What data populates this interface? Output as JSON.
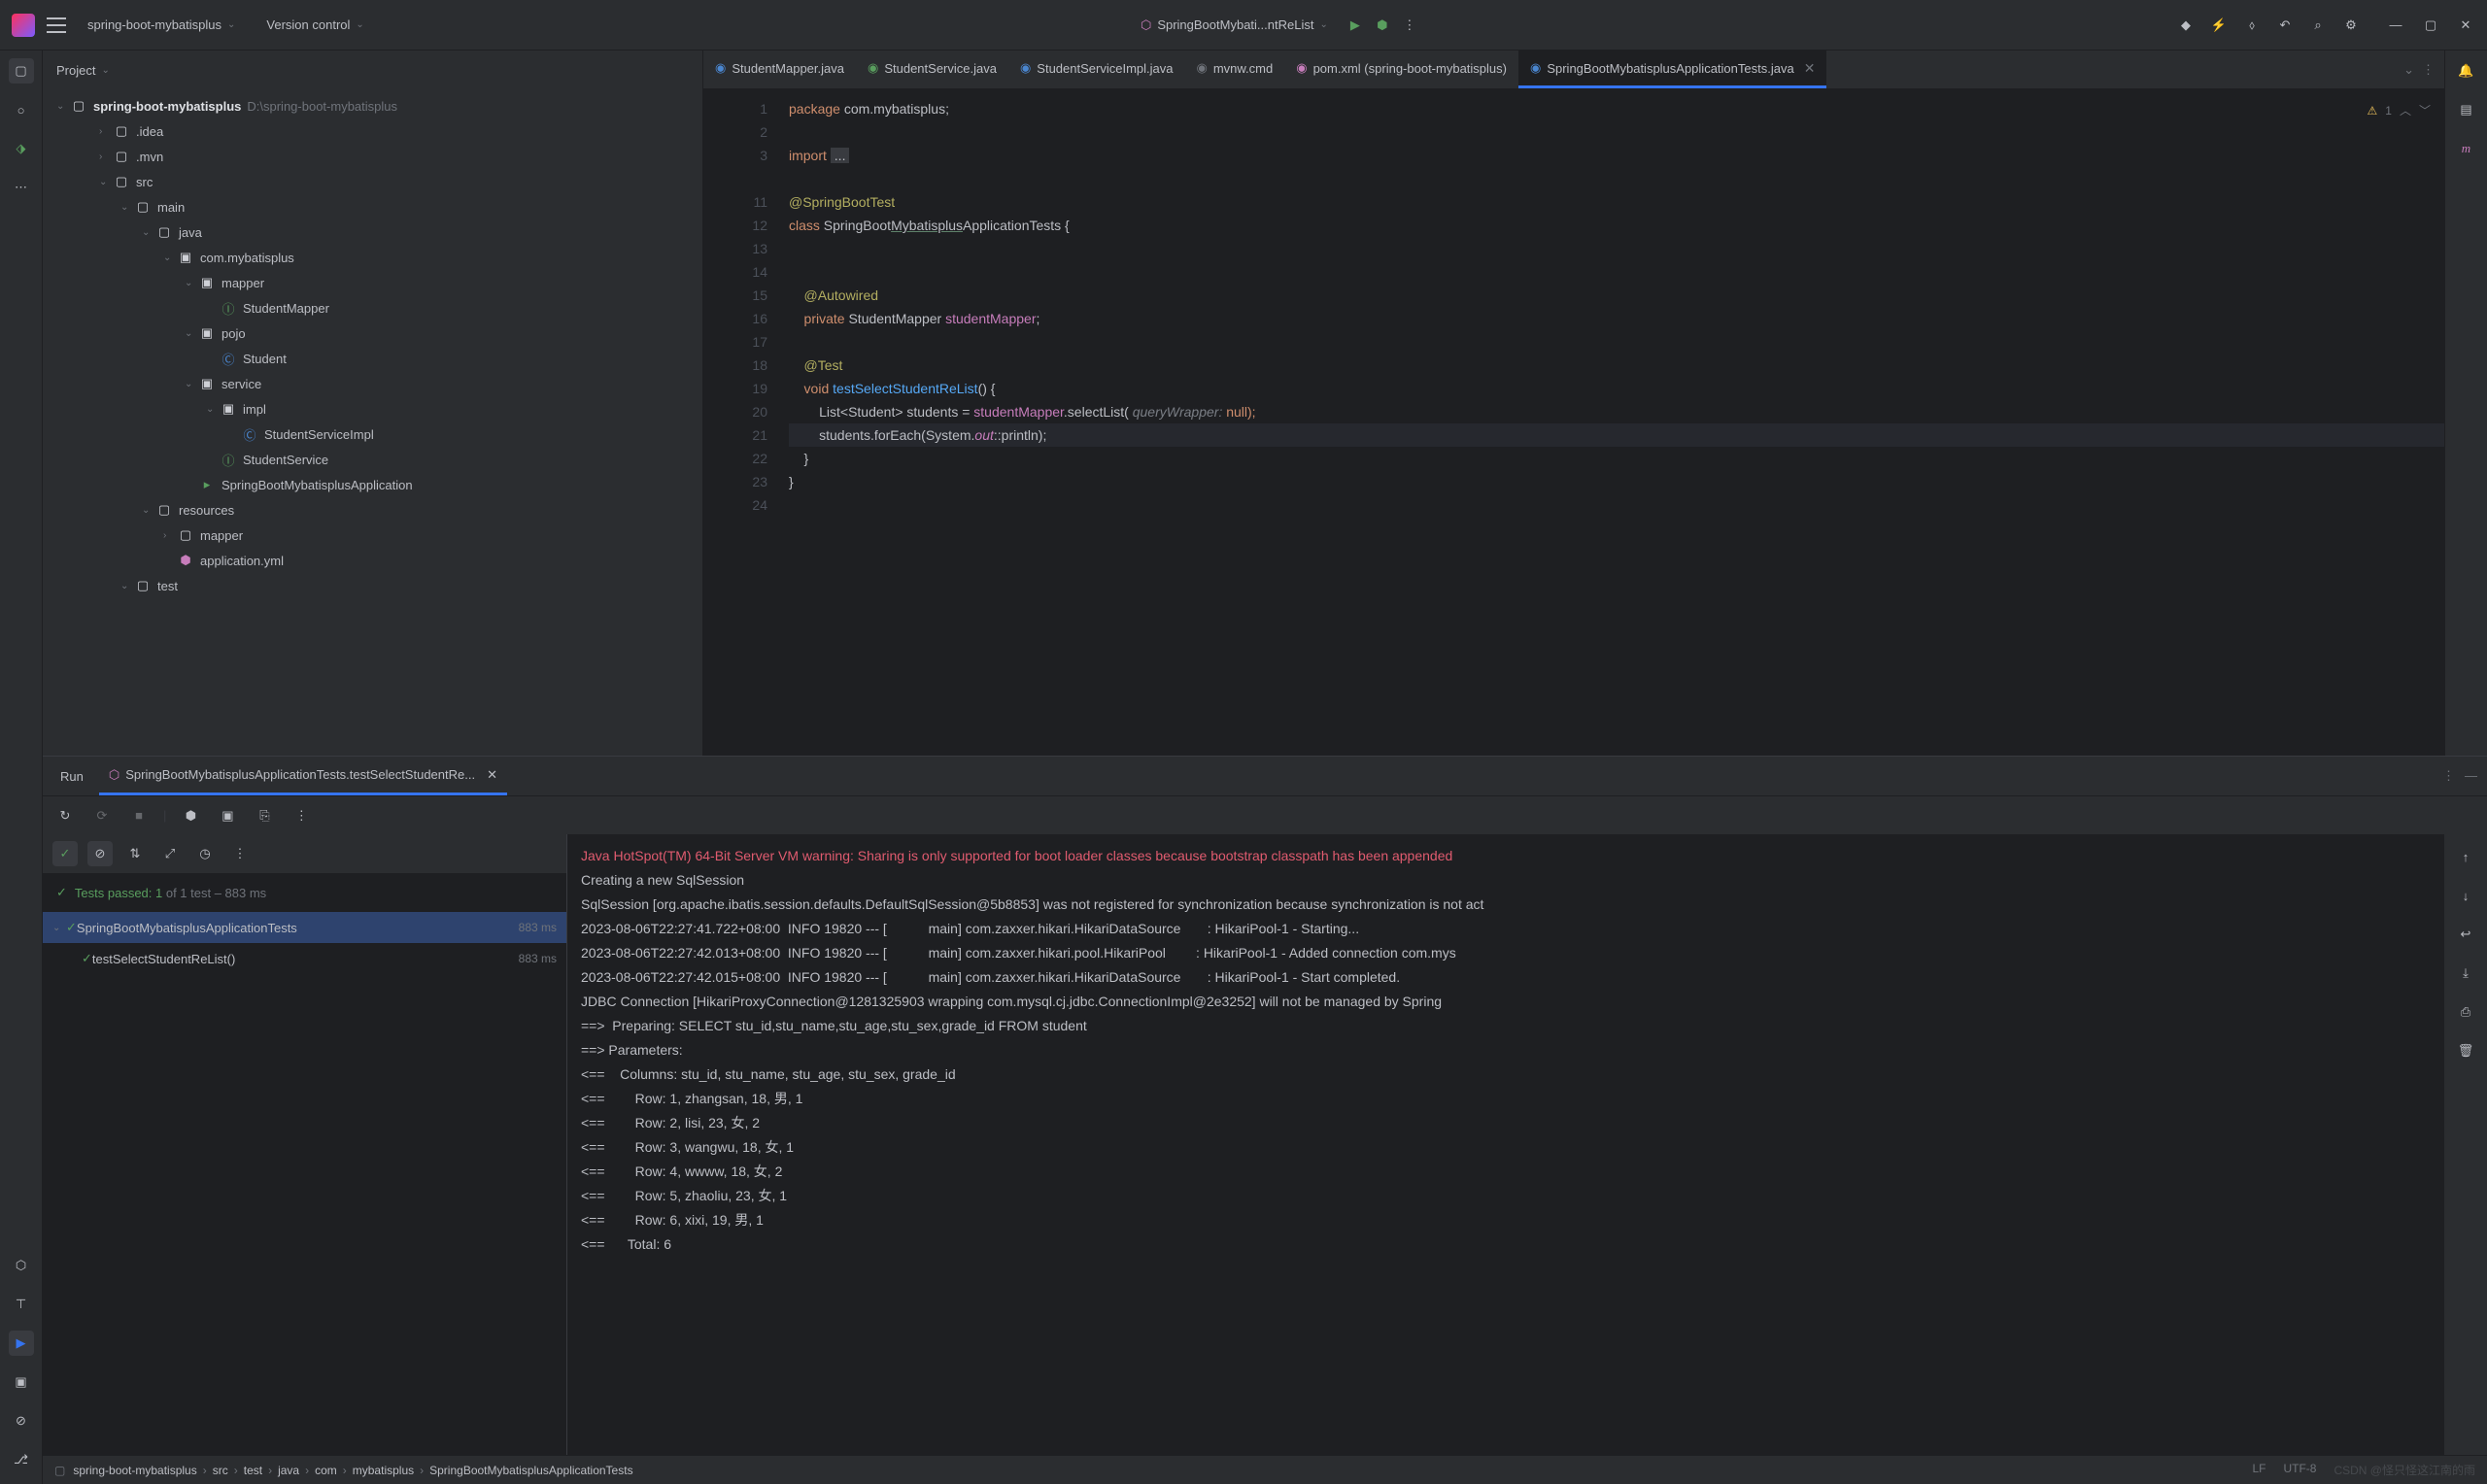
{
  "titlebar": {
    "project_name": "spring-boot-mybatisplus",
    "version_control": "Version control",
    "run_config": "SpringBootMybati...ntReList"
  },
  "project_panel": {
    "header": "Project"
  },
  "tree": {
    "root_name": "spring-boot-mybatisplus",
    "root_path": "D:\\spring-boot-mybatisplus",
    "items": [
      {
        "name": ".idea",
        "indent": 2,
        "type": "folder",
        "arrow": "›"
      },
      {
        "name": ".mvn",
        "indent": 2,
        "type": "folder",
        "arrow": "›"
      },
      {
        "name": "src",
        "indent": 2,
        "type": "folder",
        "arrow": "⌄"
      },
      {
        "name": "main",
        "indent": 3,
        "type": "folder",
        "arrow": "⌄"
      },
      {
        "name": "java",
        "indent": 4,
        "type": "folder-src",
        "arrow": "⌄"
      },
      {
        "name": "com.mybatisplus",
        "indent": 5,
        "type": "package",
        "arrow": "⌄"
      },
      {
        "name": "mapper",
        "indent": 6,
        "type": "package",
        "arrow": "⌄"
      },
      {
        "name": "StudentMapper",
        "indent": 7,
        "type": "interface",
        "arrow": ""
      },
      {
        "name": "pojo",
        "indent": 6,
        "type": "package",
        "arrow": "⌄"
      },
      {
        "name": "Student",
        "indent": 7,
        "type": "class",
        "arrow": ""
      },
      {
        "name": "service",
        "indent": 6,
        "type": "package",
        "arrow": "⌄"
      },
      {
        "name": "impl",
        "indent": 7,
        "type": "package",
        "arrow": "⌄"
      },
      {
        "name": "StudentServiceImpl",
        "indent": 8,
        "type": "class",
        "arrow": ""
      },
      {
        "name": "StudentService",
        "indent": 7,
        "type": "interface",
        "arrow": ""
      },
      {
        "name": "SpringBootMybatisplusApplication",
        "indent": 6,
        "type": "class-run",
        "arrow": ""
      },
      {
        "name": "resources",
        "indent": 4,
        "type": "folder-res",
        "arrow": "⌄"
      },
      {
        "name": "mapper",
        "indent": 5,
        "type": "folder",
        "arrow": "›"
      },
      {
        "name": "application.yml",
        "indent": 5,
        "type": "yml",
        "arrow": ""
      },
      {
        "name": "test",
        "indent": 3,
        "type": "folder",
        "arrow": "⌄"
      }
    ]
  },
  "tabs": [
    {
      "label": "StudentMapper.java",
      "icon": "#4a86cf"
    },
    {
      "label": "StudentService.java",
      "icon": "#599e5e"
    },
    {
      "label": "StudentServiceImpl.java",
      "icon": "#4a86cf"
    },
    {
      "label": "mvnw.cmd",
      "icon": "#6f737a"
    },
    {
      "label": "pom.xml (spring-boot-mybatisplus)",
      "icon": "#c77dbb"
    },
    {
      "label": "SpringBootMybatisplusApplicationTests.java",
      "icon": "#4a86cf",
      "active": true
    }
  ],
  "editor": {
    "warnings": "1",
    "lines": {
      "l1": "package com.mybatisplus;",
      "l3a": "import ",
      "l3b": "...",
      "l11": "@SpringBootTest",
      "l12a": "class ",
      "l12b": "SpringBoot",
      "l12c": "Mybatisplus",
      "l12d": "ApplicationTests {",
      "l15": "    @Autowired",
      "l16a": "    private ",
      "l16b": "StudentMapper ",
      "l16c": "studentMapper",
      "l18": "    @Test",
      "l19a": "    void ",
      "l19b": "testSelectStudentReList",
      "l19c": "() {",
      "l20a": "        List<Student> students = ",
      "l20b": "studentMapper",
      "l20c": ".selectList( ",
      "l20d": "queryWrapper: ",
      "l20e": "null);",
      "l21a": "        students.forEach(System.",
      "l21b": "out",
      "l21c": "::println);",
      "l22": "    }",
      "l23": "}"
    }
  },
  "run": {
    "label": "Run",
    "tab": "SpringBootMybatisplusApplicationTests.testSelectStudentRe...",
    "status_prefix": "Tests passed: 1",
    "status_suffix": " of 1 test – 883 ms",
    "test1": "SpringBootMybatisplusApplicationTests",
    "test1_time": "883 ms",
    "test2": "testSelectStudentReList()",
    "test2_time": "883 ms"
  },
  "console": {
    "line1": "Java HotSpot(TM) 64-Bit Server VM warning: Sharing is only supported for boot loader classes because bootstrap classpath has been appended",
    "line2": "Creating a new SqlSession",
    "line3": "SqlSession [org.apache.ibatis.session.defaults.DefaultSqlSession@5b8853] was not registered for synchronization because synchronization is not act",
    "line4": "2023-08-06T22:27:41.722+08:00  INFO 19820 --- [           main] com.zaxxer.hikari.HikariDataSource       : HikariPool-1 - Starting...",
    "line5": "2023-08-06T22:27:42.013+08:00  INFO 19820 --- [           main] com.zaxxer.hikari.pool.HikariPool        : HikariPool-1 - Added connection com.mys",
    "line6": "2023-08-06T22:27:42.015+08:00  INFO 19820 --- [           main] com.zaxxer.hikari.HikariDataSource       : HikariPool-1 - Start completed.",
    "line7": "JDBC Connection [HikariProxyConnection@1281325903 wrapping com.mysql.cj.jdbc.ConnectionImpl@2e3252] will not be managed by Spring",
    "line8": "==>  Preparing: SELECT stu_id,stu_name,stu_age,stu_sex,grade_id FROM student",
    "line9": "==> Parameters: ",
    "line10": "<==    Columns: stu_id, stu_name, stu_age, stu_sex, grade_id",
    "line11": "<==        Row: 1, zhangsan, 18, 男, 1",
    "line12": "<==        Row: 2, lisi, 23, 女, 2",
    "line13": "<==        Row: 3, wangwu, 18, 女, 1",
    "line14": "<==        Row: 4, wwww, 18, 女, 2",
    "line15": "<==        Row: 5, zhaoliu, 23, 女, 1",
    "line16": "<==        Row: 6, xixi, 19, 男, 1",
    "line17": "<==      Total: 6"
  },
  "breadcrumb": {
    "items": [
      "spring-boot-mybatisplus",
      "src",
      "test",
      "java",
      "com",
      "mybatisplus",
      "SpringBootMybatisplusApplicationTests"
    ]
  },
  "statusbar": {
    "lf": "LF",
    "encoding": "UTF-8",
    "watermark": "CSDN @怪只怪这江南的雨"
  }
}
